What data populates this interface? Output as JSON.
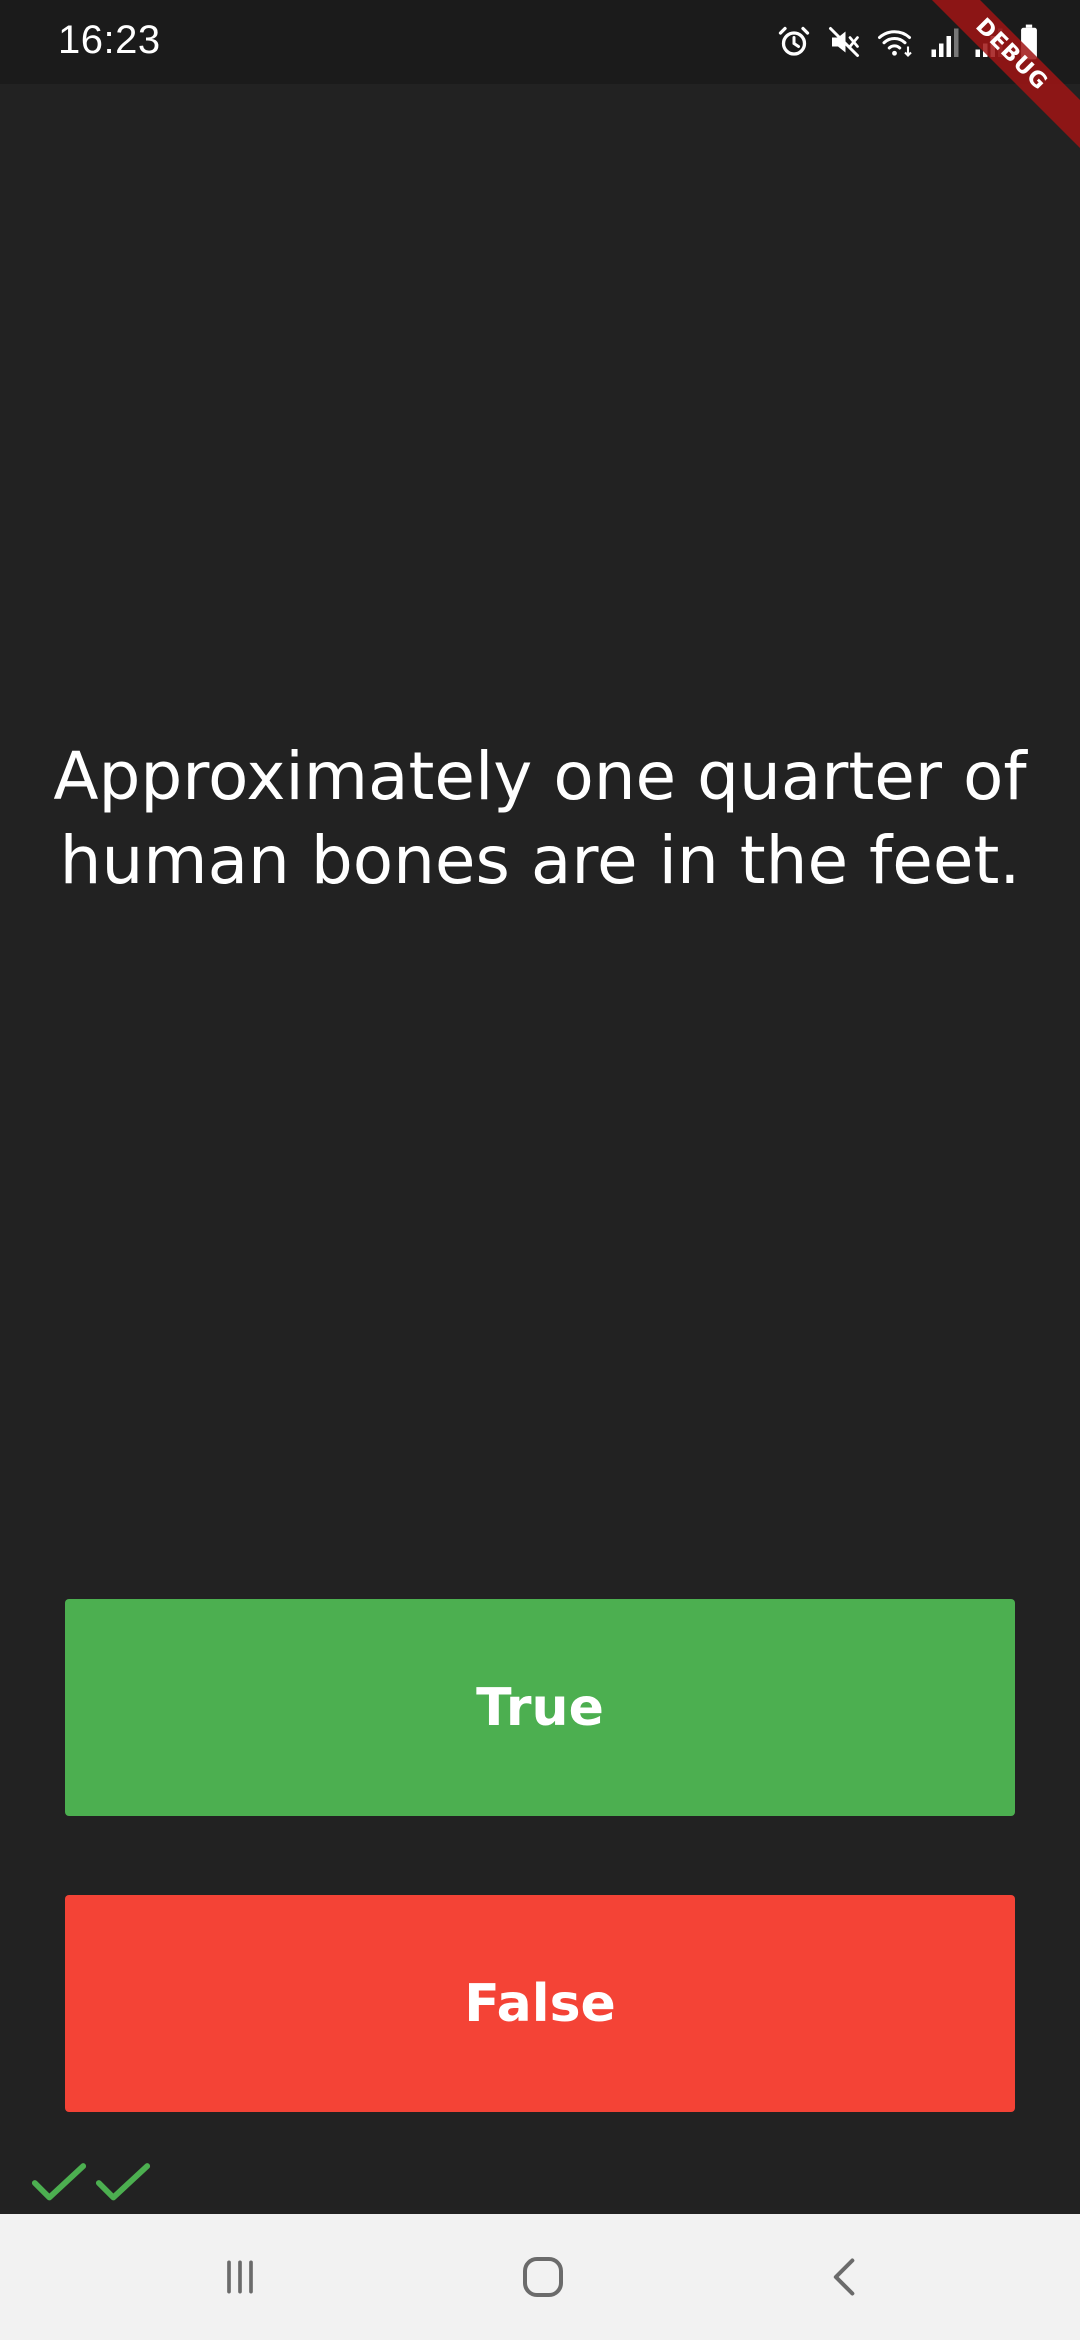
{
  "status_bar": {
    "time": "16:23",
    "icons": [
      "alarm-icon",
      "mute-icon",
      "wifi-icon",
      "signal-icon",
      "signal-icon",
      "battery-icon"
    ]
  },
  "debug_banner": {
    "label": "DEBUG"
  },
  "quiz": {
    "question": "Approximately one quarter of human bones are in the feet.",
    "true_label": "True",
    "false_label": "False",
    "score_marks": [
      "check-icon",
      "check-icon"
    ]
  },
  "nav_bar": {
    "icons": [
      "recent-apps-icon",
      "home-icon",
      "back-icon"
    ]
  },
  "colors": {
    "background": "#222222",
    "true_button": "#4caf50",
    "false_button": "#f44336",
    "check": "#4caf50"
  }
}
